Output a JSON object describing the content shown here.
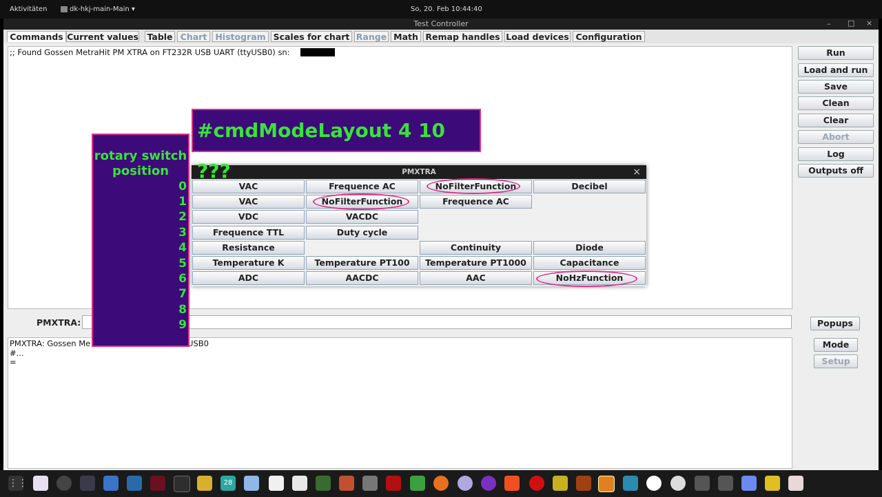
{
  "topbar": {
    "activities": "Aktivitäten",
    "app": "dk-hkj-main-Main ▾",
    "clock": "So, 20. Feb  10:44:40"
  },
  "window": {
    "title": "Test Controller",
    "controls": [
      "–",
      "□",
      "×"
    ]
  },
  "tabs": [
    {
      "label": "Commands",
      "state": "active"
    },
    {
      "label": "Current values",
      "state": "normal"
    },
    {
      "label": "Table",
      "state": "normal"
    },
    {
      "label": "Chart",
      "state": "disabled"
    },
    {
      "label": "Histogram",
      "state": "disabled"
    },
    {
      "label": "Scales for chart",
      "state": "normal"
    },
    {
      "label": "Range",
      "state": "disabled"
    },
    {
      "label": "Math",
      "state": "normal"
    },
    {
      "label": "Remap handles",
      "state": "normal"
    },
    {
      "label": "Load devices",
      "state": "normal"
    },
    {
      "label": "Configuration",
      "state": "normal"
    }
  ],
  "log": {
    "line1": ";; Found Gossen MetraHit PM XTRA on FT232R USB UART (ttyUSB0) sn:"
  },
  "side_buttons": [
    {
      "label": "Run",
      "enabled": true
    },
    {
      "label": "Load and run",
      "enabled": true
    },
    {
      "label": "Save",
      "enabled": true
    },
    {
      "label": "Clean",
      "enabled": true
    },
    {
      "label": "Clear",
      "enabled": true
    },
    {
      "label": "Abort",
      "enabled": false
    },
    {
      "label": "Log",
      "enabled": true
    },
    {
      "label": "Outputs off",
      "enabled": true
    }
  ],
  "command_row": {
    "label": "PMXTRA:",
    "value": "",
    "popups": "Popups"
  },
  "output": {
    "lines": [
      "PMXTRA: Gossen Me",
      "USB0",
      "#...",
      "="
    ]
  },
  "lower_buttons": [
    {
      "label": "Mode",
      "enabled": true
    },
    {
      "label": "Setup",
      "enabled": false
    }
  ],
  "dialog": {
    "title": "PMXTRA",
    "close": "×",
    "rows": [
      [
        "VAC",
        "Frequence AC",
        "NoFilterFunction",
        "Decibel"
      ],
      [
        "VAC",
        "NoFilterFunction",
        "Frequence AC",
        ""
      ],
      [
        "VDC",
        "VACDC",
        "",
        ""
      ],
      [
        "Frequence TTL",
        "Duty cycle",
        "",
        ""
      ],
      [
        "Resistance",
        "",
        "Continuity",
        "Diode"
      ],
      [
        "Temperature K",
        "Temperature PT100",
        "Temperature PT1000",
        "Capacitance"
      ],
      [
        "ADC",
        "AACDC",
        "AAC",
        "NoHzFunction"
      ]
    ]
  },
  "annotation": {
    "title": "#cmdModeLayout 4 10 ???",
    "rotary_label_1": "rotary switch",
    "rotary_label_2": "position",
    "positions": [
      "0",
      "1",
      "2",
      "3",
      "4",
      "5",
      "6",
      "7",
      "8",
      "9"
    ],
    "accent_color": "#e0308a",
    "text_color": "#39e33a",
    "bg_color": "#3d0a7a"
  },
  "taskbar": {
    "icons": [
      "apps-grid-icon",
      "app-icon",
      "disk-icon",
      "monitor-icon",
      "virtualbox-icon",
      "window-icon",
      "wine-icon",
      "terminal-icon",
      "puzzle-icon",
      "calendar-icon",
      "mail-icon",
      "files-icon",
      "editor-icon",
      "photo-icon",
      "spreadsheet-icon",
      "folder-icon",
      "filezilla-icon",
      "diamond-icon",
      "firefox-icon",
      "circle-icon",
      "tor-icon",
      "brave-icon",
      "opera-icon",
      "gear-icon",
      "archive-icon",
      "sun-icon",
      "kodi-icon",
      "a-icon",
      "chat-icon",
      "hp-icon",
      "hp2-icon",
      "blue-app-icon",
      "yellow-app-icon",
      "graph-app-icon"
    ],
    "calendar_day": "28"
  }
}
